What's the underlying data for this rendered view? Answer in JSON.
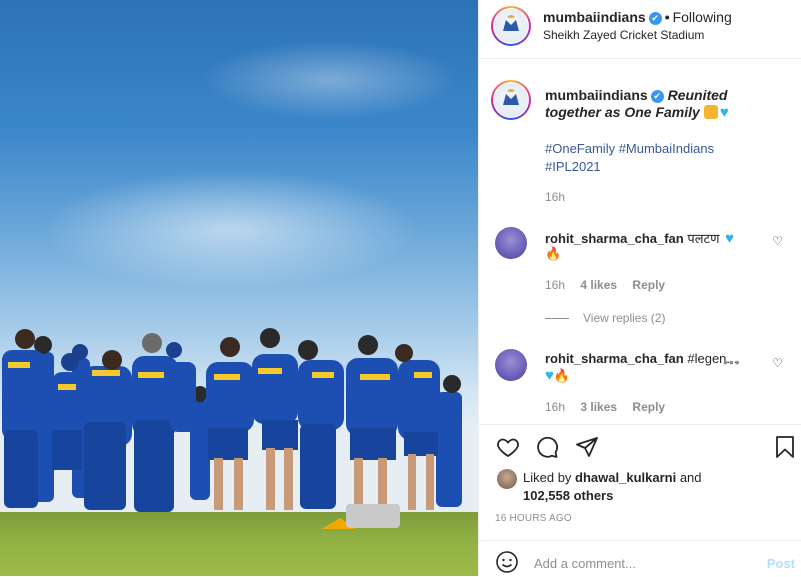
{
  "post": {
    "author": "mumbaiindians",
    "verified_mark": "✔",
    "separator": "•",
    "follow_status": "Following",
    "location": "Sheikh Zayed Cricket Stadium",
    "caption_line1": "Reunited",
    "caption_line2": "together as One Family",
    "hashtags_line1": "#OneFamily #MumbaiIndians",
    "hashtags_line2": "#IPL2021",
    "caption_time": "16h",
    "liked_by_prefix": "Liked by",
    "liked_by_user": "dhawal_kulkarni",
    "liked_by_and": "and",
    "likes_others": "102,558 others",
    "posted_ago": "16 HOURS AGO"
  },
  "comments": [
    {
      "user": "rohit_sharma_cha_fan",
      "text": "पलटण",
      "time": "16h",
      "likes": "4 likes",
      "reply": "Reply",
      "view_replies": "View replies (2)"
    },
    {
      "user": "rohit_sharma_cha_fan",
      "text": "#legen...",
      "time": "16h",
      "likes": "3 likes",
      "reply": "Reply"
    }
  ],
  "comment_box": {
    "placeholder": "Add a comment...",
    "post_label": "Post"
  },
  "icons": {
    "like": "heart-icon",
    "comment": "comment-icon",
    "share": "share-icon",
    "save": "bookmark-icon",
    "emoji": "emoji-icon",
    "more": "more-icon"
  },
  "colors": {
    "link": "#385898",
    "muted": "#8e8e8e",
    "verified": "#3897f0",
    "kit_blue": "#1d4fb3",
    "post_disabled": "#b2dffc"
  }
}
